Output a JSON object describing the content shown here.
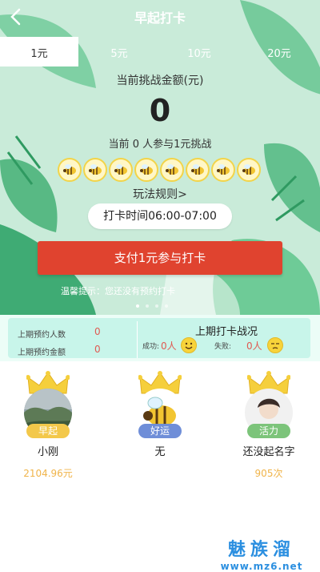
{
  "header": {
    "title": "早起打卡"
  },
  "tabs": [
    {
      "label": "1元",
      "active": true
    },
    {
      "label": "5元",
      "active": false
    },
    {
      "label": "10元",
      "active": false
    },
    {
      "label": "20元",
      "active": false
    }
  ],
  "challenge": {
    "amount_label": "当前挑战金额(元)",
    "amount": "0",
    "participants": "当前 0 人参与1元挑战",
    "rules": "玩法规则>",
    "time": "打卡时间06:00-07:00",
    "pay_button": "支付1元参与打卡",
    "tip": "温馨提示：您还没有预约打卡"
  },
  "stats": {
    "prev_count_label": "上期预约人数",
    "prev_count": "0",
    "prev_amount_label": "上期预约金额",
    "prev_amount": "0",
    "battle_title": "上期打卡战况",
    "success_label": "成功:",
    "success_val": "0人",
    "fail_label": "失败:",
    "fail_val": "0人"
  },
  "leaders": [
    {
      "badge": "早起",
      "name": "小刚",
      "value": "2104.96元",
      "badge_color": "#f3c84a"
    },
    {
      "badge": "好运",
      "name": "无",
      "value": "",
      "badge_color": "#6f8ed8"
    },
    {
      "badge": "活力",
      "name": "还没起名字",
      "value": "905次",
      "badge_color": "#7cc47a"
    }
  ],
  "watermark": {
    "big": "魅族溜",
    "small": "www.mz6.net"
  },
  "colors": {
    "accent": "#e0432f",
    "hero_bg": "#c9ebd9",
    "stats_bg": "#c8f5ea"
  }
}
